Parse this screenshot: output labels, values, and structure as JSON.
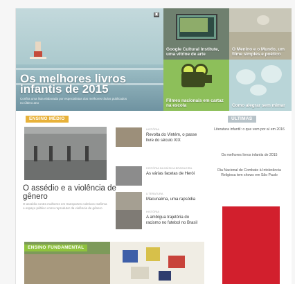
{
  "hero": {
    "title": "Os melhores livros infantis de 2015",
    "description": "Confira uma lista elaborada por especialistas dos melhores títulos publicados no último ano"
  },
  "tiles": [
    {
      "caption": "Google Cultural Institute, uma vitrine de arte"
    },
    {
      "caption": "O Menino e o Mundo, um filme simples e poético"
    },
    {
      "caption": "Filmes nacionais em cartaz na escola"
    },
    {
      "caption": "Como alegrar sem mimar"
    }
  ],
  "sections": {
    "ensino_medio": "ENSINO MÉDIO",
    "ultimas": "ÚLTIMAS",
    "ensino_fundamental": "ENSINO FUNDAMENTAL"
  },
  "main_article": {
    "title": "O assédio e a violência de gênero",
    "description": "O assédio contra mulheres em transportes coletivos reafirma o espaço público como reprodutor da violência de gênero"
  },
  "news": [
    {
      "category": "HISTÓRIA",
      "title": "Revolta do Vintém, o passe livre do século XIX"
    },
    {
      "category": "HISTÓRIA DA MÚSICA BRASILEIRA",
      "title": "As várias facetas de Herói"
    },
    {
      "category": "LITERATURA",
      "title": "Macunaíma, uma rapsódia"
    },
    {
      "category": "HISTÓRIA",
      "title": "A ambígua trajetória do racismo no futebol no Brasil"
    }
  ],
  "ultimas": [
    "Literatura infantil: o que vem por aí em 2016",
    "Os melhores livros infantis de 2015",
    "Dia Nacional de Combate à Intolerância Religiosa tem shows em São Paulo"
  ],
  "colors": {
    "ensino_medio": "#e8b23a",
    "ultimas": "#b8c3c9",
    "ensino_fundamental": "#8fc23d",
    "ad": "#d21f2d"
  }
}
